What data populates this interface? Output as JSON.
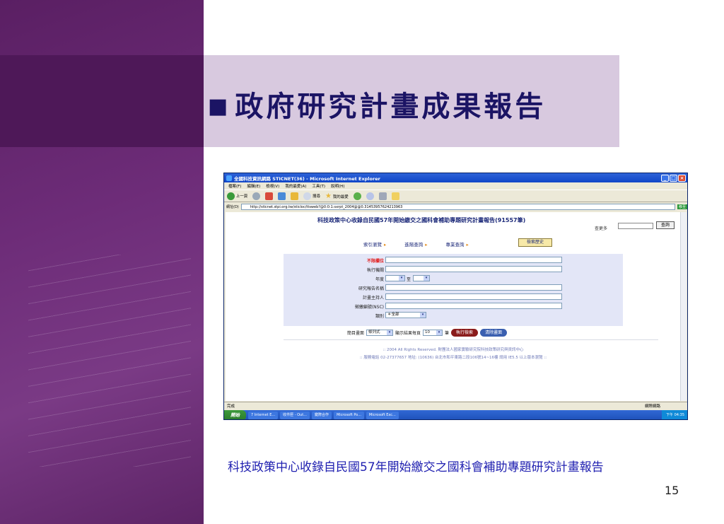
{
  "slide": {
    "title_bullet": "■",
    "title": "政府研究計畫成果報告",
    "caption": "科技政策中心收錄自民國57年開始繳交之國科會補助專題研究計畫報告",
    "page_number": "15"
  },
  "browser": {
    "window_title": "全國科技資訊網路 STICNET(36) - Microsoft Internet Explorer",
    "menu": [
      "檔案(F)",
      "編輯(E)",
      "檢視(V)",
      "我的最愛(A)",
      "工具(T)",
      "說明(H)"
    ],
    "toolbar": {
      "back": "上一頁",
      "search": "搜尋",
      "favorites": "我的最愛"
    },
    "address_label": "網址(D)",
    "address": "http://sticnet.stpi.org.tw/sticloc/ttsweb?@0:0:1:sxrpt_2004@@0.31453957624213963",
    "go": "移至",
    "status": "完成",
    "status_zone": "網際網路"
  },
  "page": {
    "heading": "科技政策中心收錄自民國57年開始繳交之國科會補助專題研究計畫報告(91557筆)",
    "search_label": "查更多",
    "search_button": "查詢",
    "tabs": [
      "索引瀏覽",
      "進階查詢",
      "專業查詢"
    ],
    "history_button": "檢索歷史",
    "form": {
      "rows": [
        {
          "label": "不限欄位"
        },
        {
          "label": "執行機關"
        },
        {
          "label": "年度"
        },
        {
          "label": "研究報告名稱"
        },
        {
          "label": "計畫主持人"
        },
        {
          "label": "徵繳編號(NSC)"
        },
        {
          "label": "類別"
        }
      ],
      "year_sep": "至",
      "category_value": "＊全部"
    },
    "options": {
      "list_label": "簡目畫面",
      "list_value": "條列式",
      "per_page_label": "顯示結果每頁",
      "per_page_value": "10",
      "unit": "筆",
      "search_btn": "執行檢索",
      "clear_btn": "清除畫面"
    },
    "footer1": ":: 2004 All Rights Reserved. 財團法人國家實驗研究院科技政策研究與資訊中心",
    "footer2": ":: 服務電話 02-27377657 地址: (10636) 台北市和平東路二段106號14~16樓 請用 IE5.5 以上版本瀏覽 ::"
  },
  "taskbar": {
    "start": "開始",
    "tasks": [
      "7 Internet E...",
      "收件匣 - Out...",
      "鍵際合作",
      "Microsoft Po...",
      "Microsoft Exc..."
    ],
    "clock": "下午 04:35"
  }
}
